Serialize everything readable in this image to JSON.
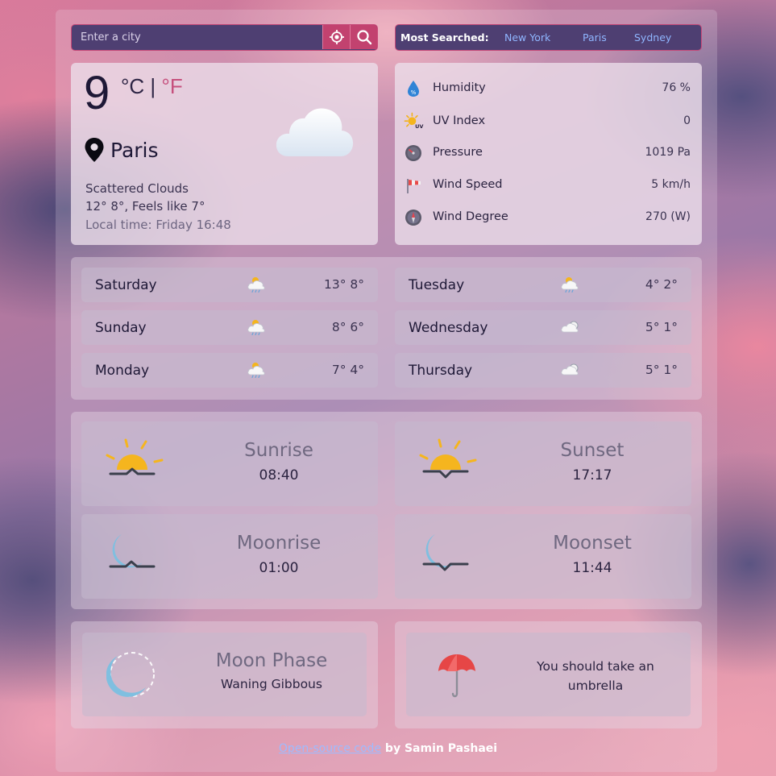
{
  "search": {
    "placeholder": "Enter a city"
  },
  "most_searched": {
    "label": "Most Searched:",
    "cities": [
      "New York",
      "Paris",
      "Sydney"
    ]
  },
  "current": {
    "temp": "9",
    "unit_c": "°C",
    "separator": "|",
    "unit_f": "°F",
    "city": "Paris",
    "condition": "Scattered Clouds",
    "minmax_feels": "12° 8°, Feels like 7°",
    "local_time": "Local time: Friday 16:48"
  },
  "details": [
    {
      "label": "Humidity",
      "value": "76 %",
      "icon": "humidity-icon"
    },
    {
      "label": "UV Index",
      "value": "0",
      "icon": "uv-index-icon"
    },
    {
      "label": "Pressure",
      "value": "1019 Pa",
      "icon": "pressure-gauge-icon"
    },
    {
      "label": "Wind Speed",
      "value": "5 km/h",
      "icon": "windsock-icon"
    },
    {
      "label": "Wind Degree",
      "value": "270 (W)",
      "icon": "compass-icon"
    }
  ],
  "forecast": [
    {
      "day": "Saturday",
      "temps": "13° 8°",
      "icon": "cloud-rain-icon"
    },
    {
      "day": "Sunday",
      "temps": "8° 6°",
      "icon": "cloud-rain-icon"
    },
    {
      "day": "Monday",
      "temps": "7° 4°",
      "icon": "cloud-rain-icon"
    },
    {
      "day": "Tuesday",
      "temps": "4° 2°",
      "icon": "cloud-rain-icon"
    },
    {
      "day": "Wednesday",
      "temps": "5° 1°",
      "icon": "partly-cloudy-icon"
    },
    {
      "day": "Thursday",
      "temps": "5° 1°",
      "icon": "partly-cloudy-icon"
    }
  ],
  "astro": {
    "sunrise": {
      "title": "Sunrise",
      "time": "08:40"
    },
    "sunset": {
      "title": "Sunset",
      "time": "17:17"
    },
    "moonrise": {
      "title": "Moonrise",
      "time": "01:00"
    },
    "moonset": {
      "title": "Moonset",
      "time": "11:44"
    }
  },
  "moon_phase": {
    "title": "Moon Phase",
    "value": "Waning Gibbous"
  },
  "advice": {
    "text": "You should take an umbrella"
  },
  "footer": {
    "link": "Open-source code",
    "by": " by Samin Pashaei"
  },
  "colors": {
    "accent": "#c2426f",
    "panel": "#4e3f72",
    "link": "#8fb6ff"
  }
}
